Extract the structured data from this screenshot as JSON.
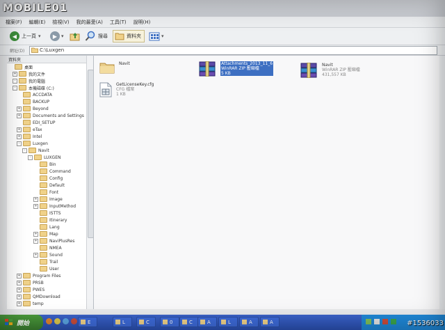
{
  "watermark_logo": "MOBILE01",
  "menu": [
    "檔案(F)",
    "編輯(E)",
    "檢視(V)",
    "我的最愛(A)",
    "工具(T)",
    "說明(H)"
  ],
  "toolbar": {
    "back_label": "上一頁",
    "search_label": "搜尋",
    "folders_label": "資料夾"
  },
  "address": {
    "label": "網址(D)",
    "path": "C:\\Luxgen"
  },
  "left_pane": {
    "title": "資料夾",
    "tree": [
      {
        "label": "桌面",
        "level": 0,
        "exp": ""
      },
      {
        "label": "我的文件",
        "level": 1,
        "exp": "+"
      },
      {
        "label": "我的電腦",
        "level": 1,
        "exp": "-"
      },
      {
        "label": "本機磁碟 (C:)",
        "level": 2,
        "exp": "-"
      },
      {
        "label": "ACCDATA",
        "level": 3,
        "exp": ""
      },
      {
        "label": "BACKUP",
        "level": 3,
        "exp": ""
      },
      {
        "label": "Beyond",
        "level": 3,
        "exp": "+"
      },
      {
        "label": "Documents and Settings",
        "level": 3,
        "exp": "+"
      },
      {
        "label": "EDI_SETUP",
        "level": 3,
        "exp": ""
      },
      {
        "label": "eTax",
        "level": 3,
        "exp": "+"
      },
      {
        "label": "Intel",
        "level": 3,
        "exp": "+"
      },
      {
        "label": "Luxgen",
        "level": 3,
        "exp": "-"
      },
      {
        "label": "Navit",
        "level": 4,
        "exp": "-"
      },
      {
        "label": "LUXGEN",
        "level": 5,
        "exp": "-"
      },
      {
        "label": "Bin",
        "level": 6,
        "exp": ""
      },
      {
        "label": "Command",
        "level": 6,
        "exp": ""
      },
      {
        "label": "Config",
        "level": 6,
        "exp": ""
      },
      {
        "label": "Default",
        "level": 6,
        "exp": ""
      },
      {
        "label": "Font",
        "level": 6,
        "exp": ""
      },
      {
        "label": "Image",
        "level": 6,
        "exp": "+"
      },
      {
        "label": "InputMethod",
        "level": 6,
        "exp": "+"
      },
      {
        "label": "ISTTS",
        "level": 6,
        "exp": ""
      },
      {
        "label": "Itinerary",
        "level": 6,
        "exp": ""
      },
      {
        "label": "Lang",
        "level": 6,
        "exp": ""
      },
      {
        "label": "Map",
        "level": 6,
        "exp": "+"
      },
      {
        "label": "NaviPlusRes",
        "level": 6,
        "exp": "+"
      },
      {
        "label": "NMEA",
        "level": 6,
        "exp": ""
      },
      {
        "label": "Sound",
        "level": 6,
        "exp": "+"
      },
      {
        "label": "Trail",
        "level": 6,
        "exp": ""
      },
      {
        "label": "User",
        "level": 6,
        "exp": ""
      },
      {
        "label": "Program Files",
        "level": 3,
        "exp": "+"
      },
      {
        "label": "PRSB",
        "level": 3,
        "exp": "+"
      },
      {
        "label": "PWES",
        "level": 3,
        "exp": "+"
      },
      {
        "label": "QMDownload",
        "level": 3,
        "exp": "+"
      },
      {
        "label": "temp",
        "level": 3,
        "exp": "+"
      }
    ]
  },
  "files": [
    {
      "name": "Navit",
      "type": "",
      "size": "",
      "icon": "folder-icon",
      "selected": false
    },
    {
      "name": "Attachments_2013_11_6",
      "type": "WinRAR ZIP 壓縮檔",
      "size": "5 KB",
      "icon": "winrar-icon",
      "selected": true
    },
    {
      "name": "Navit",
      "type": "WinRAR ZIP 壓縮檔",
      "size": "431,557 KB",
      "icon": "winrar-icon",
      "selected": false
    },
    {
      "name": "GetLicenseKey.cfg",
      "type": "CFG 檔案",
      "size": "1 KB",
      "icon": "cfg-file-icon",
      "selected": false
    }
  ],
  "taskbar": {
    "start_label": "開始",
    "tasks": [
      "E",
      "L",
      "C",
      "0",
      "C",
      "A",
      "L",
      "A",
      "A"
    ]
  },
  "watermark_id": "#1536033"
}
